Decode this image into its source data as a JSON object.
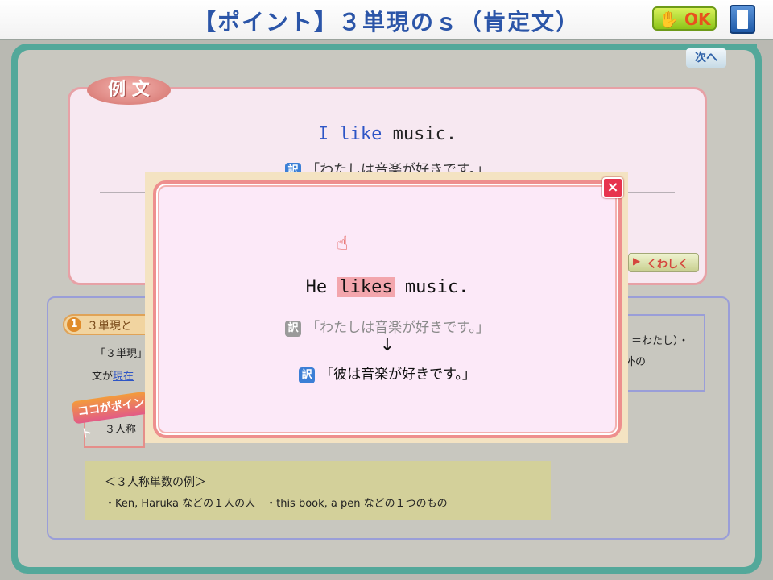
{
  "header": {
    "title": "【ポイント】３単現のｓ（肯定文）",
    "ok_label": "OK",
    "ok_icon": "hand-icon",
    "exit_icon": "door-exit-icon"
  },
  "nav": {
    "next_label": "次へ"
  },
  "example": {
    "label": "例 文",
    "sentence": {
      "subject_verb": "I like",
      "object": "music."
    },
    "translation_badge": "訳",
    "translation": "「わたしは音楽が好きです。」",
    "detail_label": "くわしく"
  },
  "explanation": {
    "section_num": "1",
    "section_title": "３単現と",
    "line1": "「３単現」",
    "line2_prefix": "文が",
    "line2_keyword": "現在",
    "right_line1": "＝わたし）・",
    "right_line2": "外の",
    "point_stamp": "ココがポイント",
    "point_text": "３人称",
    "examples_title": "＜３人称単数の例＞",
    "examples_items": "・Ken, Haruka などの１人の人　・this book, a pen などの１つのもの"
  },
  "modal": {
    "close_label": "×",
    "pointer_icon": "pointing-hand-icon",
    "sentence": {
      "subject": "He",
      "verb": "likes",
      "object": "music."
    },
    "translation_badge": "訳",
    "old_translation": "「わたしは音楽が好きです。」",
    "arrow": "↓",
    "new_translation": "「彼は音楽が好きです。」"
  },
  "colors": {
    "title": "#2b55a8",
    "accent_blue": "#2d55c6",
    "highlight": "#f3a6ad",
    "modal_border": "#ee8f8e",
    "frame_teal": "#53a89a"
  }
}
